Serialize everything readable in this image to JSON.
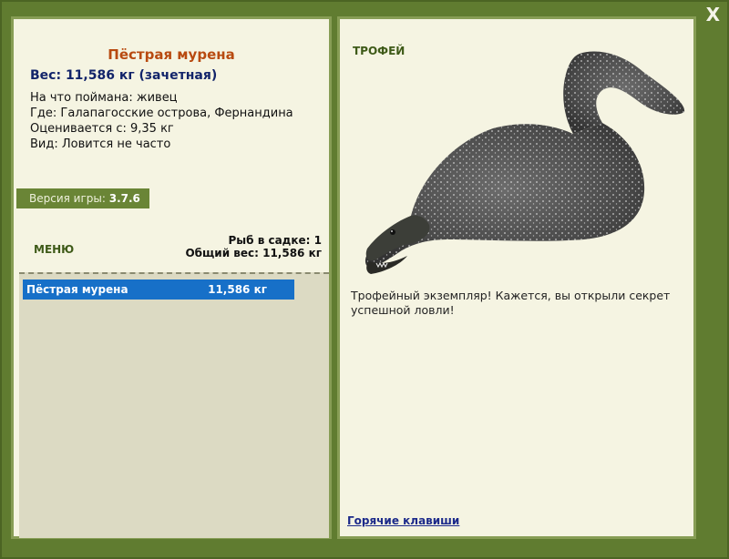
{
  "window": {
    "close_label": "X"
  },
  "fish": {
    "name": "Пёстрая мурена",
    "weight_line": "Вес: 11,586 кг (зачетная)",
    "caught_on": "На что поймана: живец",
    "location": "Где: Галапагосские острова, Фернандина",
    "valued_from": "Оценивается с: 9,35 кг",
    "rarity": "Вид: Ловится не часто"
  },
  "version": {
    "label": "Версия игры:",
    "value": "3.7.6"
  },
  "menu": {
    "label": "МЕНЮ"
  },
  "cage": {
    "count_line": "Рыб в садке: 1",
    "total_line": "Общий вес: 11,586 кг"
  },
  "catch_list": [
    {
      "name": "Пёстрая мурена",
      "weight": "11,586 кг"
    }
  ],
  "trophy": {
    "label": "ТРОФЕЙ",
    "description": "Трофейный экземпляр! Кажется, вы открыли секрет успешной ловли!",
    "image": "moray-eel"
  },
  "footer": {
    "hotkeys_label": "Горячие клавиши"
  },
  "colors": {
    "frame": "#607c30",
    "panel": "#f5f4e2",
    "title": "#b84a10",
    "weight": "#12246a",
    "selection": "#1770c8"
  }
}
